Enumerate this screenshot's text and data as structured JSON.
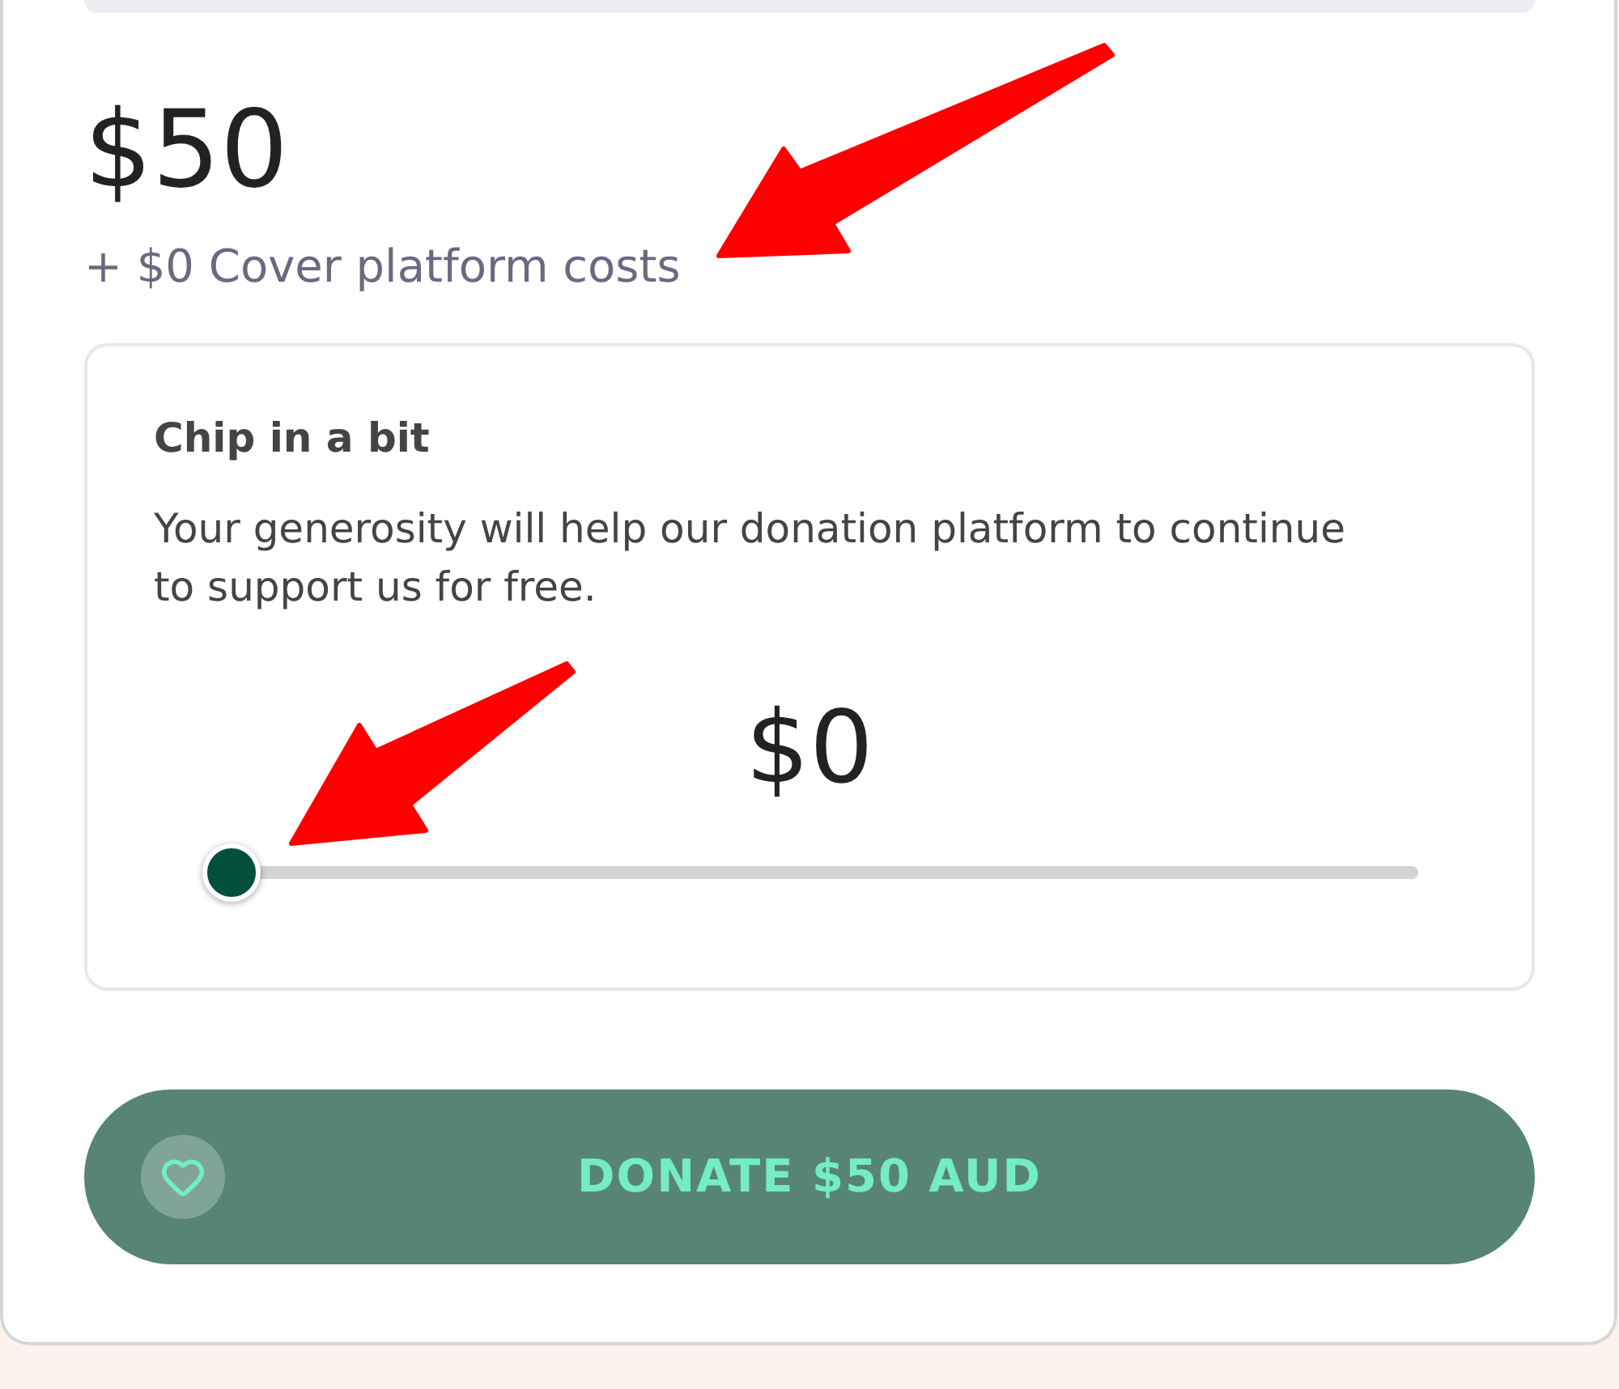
{
  "total": {
    "amount": "$50",
    "fee_note": "+ $0 Cover platform costs"
  },
  "tip_panel": {
    "title": "Chip in a bit",
    "description": "Your generosity will help our donation platform to continue to support us for free.",
    "amount": "$0",
    "slider": {
      "level": 0
    }
  },
  "donate_button": {
    "label": "DONATE $50 AUD"
  }
}
